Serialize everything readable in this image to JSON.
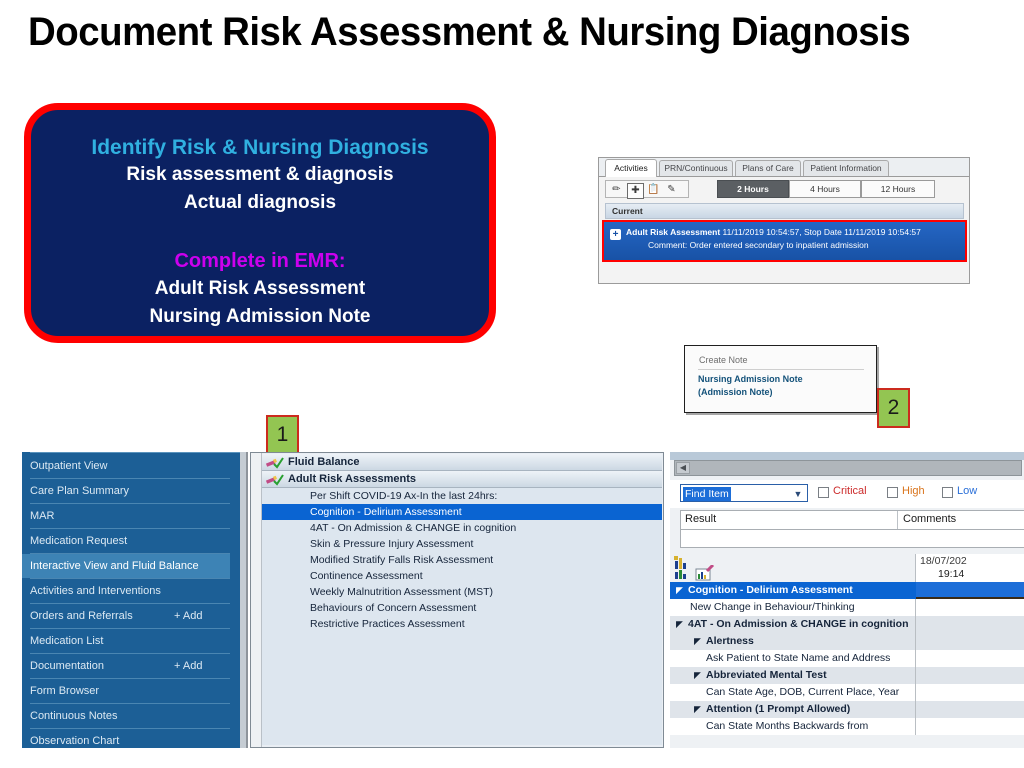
{
  "slide": {
    "title": "Document Risk Assessment & Nursing Diagnosis"
  },
  "callout": {
    "heading": "Identify Risk & Nursing Diagnosis",
    "line1": "Risk assessment & diagnosis",
    "line2": "Actual diagnosis",
    "emr_label": "Complete in EMR:",
    "emr_item1": "Adult Risk Assessment",
    "emr_item2": "Nursing Admission Note",
    "border_color": "#ff0000",
    "background_color": "#0b2162",
    "heading_color": "#30b0e0",
    "emr_color": "#cc00ee"
  },
  "activities_window": {
    "tabs": [
      {
        "label": "Activities",
        "selected": true
      },
      {
        "label": "PRN/Continuous",
        "selected": false
      },
      {
        "label": "Plans of Care",
        "selected": false
      },
      {
        "label": "Patient Information",
        "selected": false
      }
    ],
    "toolbar_icons": [
      "syringe-icon",
      "add-box-icon",
      "clipboard-icon",
      "signed-document-icon"
    ],
    "time_buttons": [
      {
        "label": "2 Hours",
        "selected": true
      },
      {
        "label": "4 Hours",
        "selected": false
      },
      {
        "label": "12 Hours",
        "selected": false
      }
    ],
    "section_header": "Current",
    "order_row": {
      "name": "Adult Risk Assessment",
      "detail": "11/11/2019 10:54:57, Stop Date 11/11/2019 10:54:57",
      "comment": "Comment: Order entered secondary to inpatient admission",
      "highlight_color": "#1852a6",
      "callout_border": "#ff0000"
    }
  },
  "create_note": {
    "header": "Create Note",
    "link_line1": "Nursing Admission Note",
    "link_line2": "(Admission Note)"
  },
  "badges": [
    {
      "label": "1",
      "fill": "#93c552",
      "border": "#cc2b1e"
    },
    {
      "label": "2",
      "fill": "#93c552",
      "border": "#cc2b1e"
    }
  ],
  "emr": {
    "nav": {
      "items": [
        {
          "label": "Outpatient View",
          "add": null,
          "selected": false
        },
        {
          "label": "Care Plan Summary",
          "add": null,
          "selected": false
        },
        {
          "label": "MAR",
          "add": null,
          "selected": false
        },
        {
          "label": "Medication Request",
          "add": null,
          "selected": false
        },
        {
          "label": "Interactive View and Fluid Balance",
          "add": null,
          "selected": true
        },
        {
          "label": "Activities and Interventions",
          "add": null,
          "selected": false
        },
        {
          "label": "Orders and Referrals",
          "add": "+ Add",
          "selected": false
        },
        {
          "label": "Medication List",
          "add": null,
          "selected": false
        },
        {
          "label": "Documentation",
          "add": "+ Add",
          "selected": false
        },
        {
          "label": "Form Browser",
          "add": null,
          "selected": false
        },
        {
          "label": "Continuous Notes",
          "add": null,
          "selected": false
        },
        {
          "label": "Observation Chart",
          "add": null,
          "selected": false
        }
      ]
    },
    "navigator": {
      "sections": [
        {
          "label": "Fluid Balance",
          "icon": "pen-check-icon"
        },
        {
          "label": "Adult Risk Assessments",
          "icon": "pen-check-icon"
        }
      ],
      "items": [
        {
          "label": "Per Shift COVID-19 Ax-In the last 24hrs:",
          "selected": false
        },
        {
          "label": "Cognition - Delirium Assessment",
          "selected": true
        },
        {
          "label": "4AT - On Admission & CHANGE in cognition",
          "selected": false
        },
        {
          "label": "Skin & Pressure Injury Assessment",
          "selected": false
        },
        {
          "label": "Modified Stratify Falls Risk Assessment",
          "selected": false
        },
        {
          "label": "Continence Assessment",
          "selected": false
        },
        {
          "label": "Weekly Malnutrition Assessment (MST)",
          "selected": false
        },
        {
          "label": "Behaviours of Concern Assessment",
          "selected": false
        },
        {
          "label": "Restrictive Practices Assessment",
          "selected": false
        }
      ]
    },
    "flowsheet": {
      "find_item_value": "Find Item",
      "filters": [
        {
          "label": "Critical",
          "color": "#cc2b2b",
          "checked": false
        },
        {
          "label": "High",
          "color": "#d9731a",
          "checked": false
        },
        {
          "label": "Low",
          "color": "#2a6fd8",
          "checked": false
        }
      ],
      "result_header": "Result",
      "comments_header": "Comments",
      "column_date": "18/07/202",
      "column_time": "19:14",
      "rows": [
        {
          "label": "Cognition - Delirium Assessment",
          "level": 0,
          "type": "group",
          "selected": true
        },
        {
          "label": "New Change in Behaviour/Thinking",
          "level": 1,
          "type": "item",
          "selected": false
        },
        {
          "label": "4AT - On Admission & CHANGE in cognition",
          "level": 0,
          "type": "group",
          "selected": false
        },
        {
          "label": "Alertness",
          "level": 1,
          "type": "group",
          "selected": false
        },
        {
          "label": "Ask Patient to State Name and Address",
          "level": 2,
          "type": "item",
          "selected": false
        },
        {
          "label": "Abbreviated Mental Test",
          "level": 1,
          "type": "group",
          "selected": false
        },
        {
          "label": "Can State Age, DOB, Current Place, Year",
          "level": 2,
          "type": "item",
          "selected": false
        },
        {
          "label": "Attention (1 Prompt Allowed)",
          "level": 1,
          "type": "group",
          "selected": false
        },
        {
          "label": "Can State Months Backwards from",
          "level": 2,
          "type": "item",
          "selected": false
        }
      ]
    }
  }
}
